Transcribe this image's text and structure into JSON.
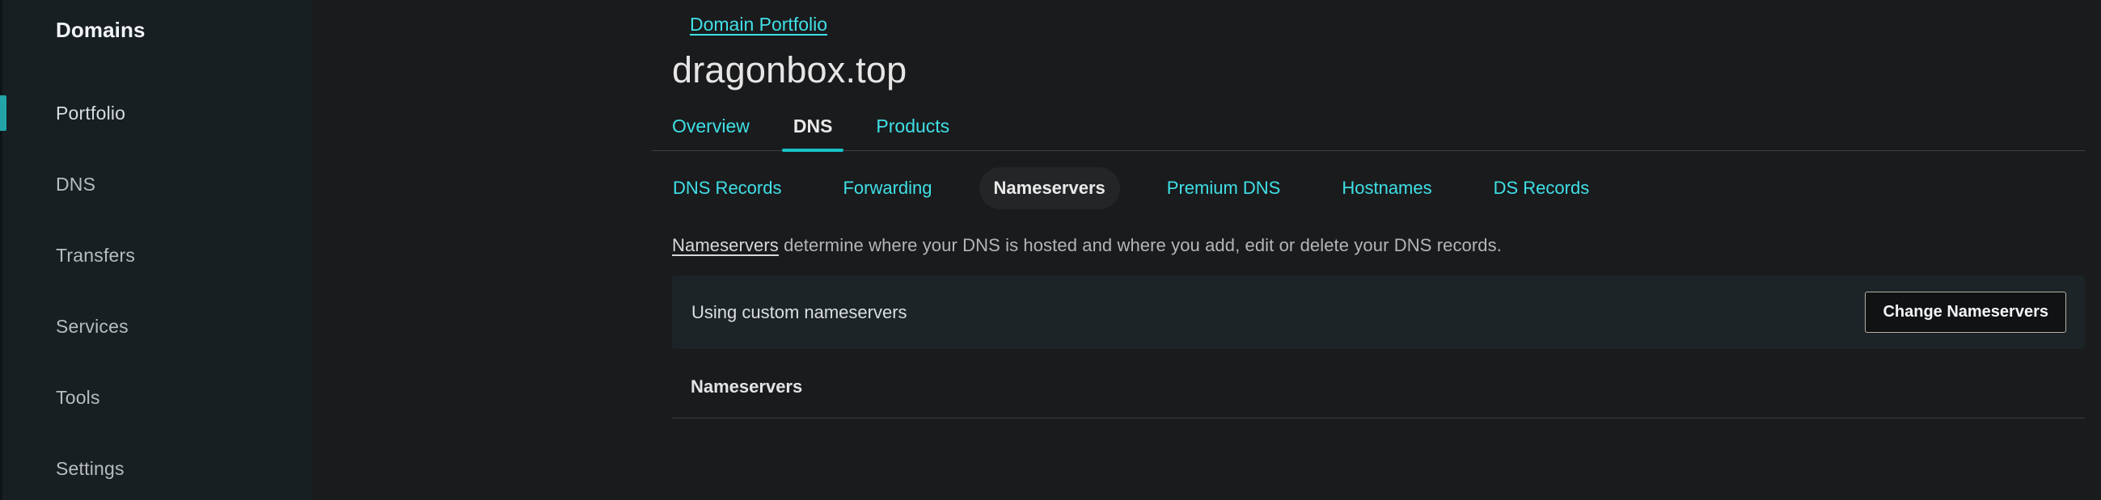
{
  "sidebar": {
    "title": "Domains",
    "items": [
      {
        "label": "Portfolio",
        "active": true
      },
      {
        "label": "DNS",
        "active": false
      },
      {
        "label": "Transfers",
        "active": false
      },
      {
        "label": "Services",
        "active": false
      },
      {
        "label": "Tools",
        "active": false
      },
      {
        "label": "Settings",
        "active": false
      }
    ]
  },
  "breadcrumb": {
    "label": "Domain Portfolio"
  },
  "header": {
    "domain": "dragonbox.top"
  },
  "tabs": [
    {
      "label": "Overview",
      "active": false
    },
    {
      "label": "DNS",
      "active": true
    },
    {
      "label": "Products",
      "active": false
    }
  ],
  "subtabs": [
    {
      "label": "DNS Records",
      "active": false
    },
    {
      "label": "Forwarding",
      "active": false
    },
    {
      "label": "Nameservers",
      "active": true
    },
    {
      "label": "Premium DNS",
      "active": false
    },
    {
      "label": "Hostnames",
      "active": false
    },
    {
      "label": "DS Records",
      "active": false
    }
  ],
  "description": {
    "term": "Nameservers",
    "rest": " determine where your DNS is hosted and where you add, edit or delete your DNS records."
  },
  "status_panel": {
    "status_text": "Using custom nameservers",
    "button_label": "Change Nameservers"
  },
  "nameservers_section": {
    "heading": "Nameservers"
  },
  "colors": {
    "accent_teal": "#18c2c6",
    "link_teal": "#3fe0e6",
    "sidebar_bg": "#171f23",
    "main_bg": "#1a1b1d",
    "panel_bg": "#1c2428",
    "pill_bg": "#232527"
  }
}
